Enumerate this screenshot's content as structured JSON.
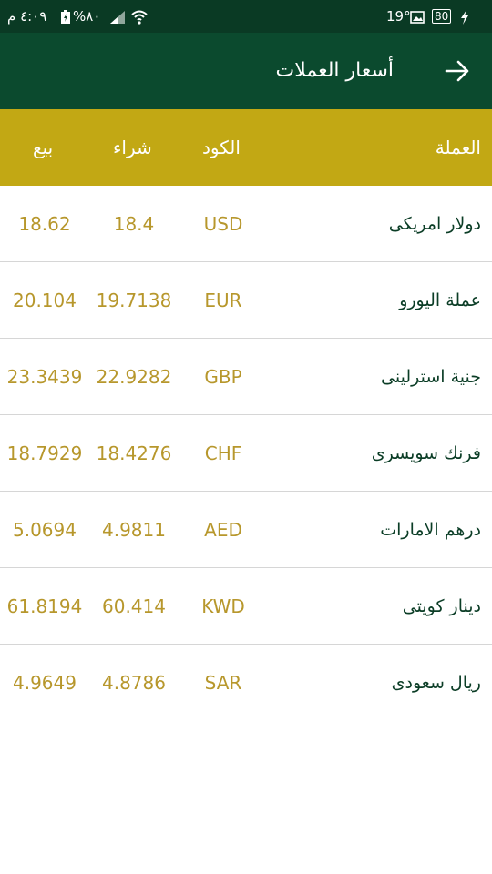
{
  "status_bar": {
    "time": "٤:٠٩ م",
    "battery_pct": "%٨٠",
    "temperature": "19°",
    "battery_box": "80",
    "icons": [
      "signal-icon",
      "wifi-icon",
      "image-icon",
      "bolt-icon"
    ]
  },
  "app_bar": {
    "title": "أسعار العملات",
    "back_icon": "arrow-right-icon"
  },
  "table": {
    "headers": {
      "currency": "العملة",
      "code": "الكود",
      "buy": "شراء",
      "sell": "بيع"
    },
    "rows": [
      {
        "name": "دولار امريكى",
        "code": "USD",
        "buy": "18.4",
        "sell": "18.62"
      },
      {
        "name": "عملة اليورو",
        "code": "EUR",
        "buy": "19.7138",
        "sell": "20.104"
      },
      {
        "name": "جنية استرلينى",
        "code": "GBP",
        "buy": "22.9282",
        "sell": "23.3439"
      },
      {
        "name": "فرنك سويسرى",
        "code": "CHF",
        "buy": "18.4276",
        "sell": "18.7929"
      },
      {
        "name": "درهم الامارات",
        "code": "AED",
        "buy": "4.9811",
        "sell": "5.0694"
      },
      {
        "name": "دينار كويتى",
        "code": "KWD",
        "buy": "60.414",
        "sell": "61.8194"
      },
      {
        "name": "ريال سعودى",
        "code": "SAR",
        "buy": "4.8786",
        "sell": "4.9649"
      }
    ]
  },
  "colors": {
    "status_bar": "#0a3a24",
    "app_bar": "#0b4a2e",
    "header_gold": "#c2a814",
    "value_gold": "#b7972c",
    "name_text": "#0b3d26"
  }
}
